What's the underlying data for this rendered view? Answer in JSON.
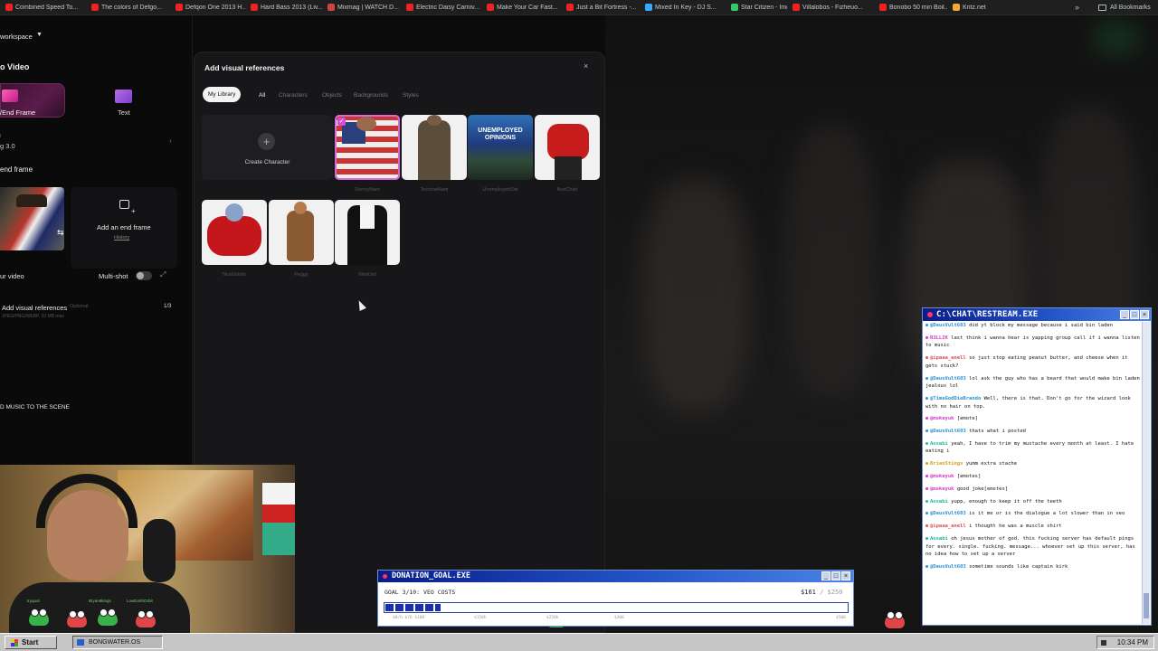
{
  "bookmarks": [
    {
      "label": "Combined Speed To...",
      "color": "#e22"
    },
    {
      "label": "The colors of Defgo...",
      "color": "#e22"
    },
    {
      "label": "Defqon One 2013 H...",
      "color": "#e22"
    },
    {
      "label": "Hard Bass 2013 (Liv...",
      "color": "#e22"
    },
    {
      "label": "Mixmag | WATCH D...",
      "color": "#c44"
    },
    {
      "label": "Electric Daisy Carniv...",
      "color": "#e22"
    },
    {
      "label": "Make Your Car Fast...",
      "color": "#e22"
    },
    {
      "label": "Just a Bit Fortress -...",
      "color": "#e22"
    },
    {
      "label": "Mixed In Key - DJ S...",
      "color": "#3af"
    },
    {
      "label": "Star Citizen - Imgur",
      "color": "#3c6"
    },
    {
      "label": "Villalobos - Fizheuo...",
      "color": "#e22"
    },
    {
      "label": "Bonobo 50 min Boil...",
      "color": "#e22"
    },
    {
      "label": "Kritz.net",
      "color": "#ea3"
    }
  ],
  "bookmarks_more": "»",
  "all_bookmarks": "All Bookmarks",
  "left_panel": {
    "workspace": "workspace",
    "section_title": "o Video",
    "mode_frame": "/End Frame",
    "mode_text": "Text",
    "model_small": "l",
    "model": "g 3.0",
    "model_chevron": "›",
    "end_frame_title": "end frame",
    "add_end_frame": "Add an end frame",
    "history": "History",
    "your_video": "ur video",
    "multishot": "Multi-shot",
    "expand": "⤢",
    "add_visual_refs": "Add visual references",
    "optional": "Optional",
    "refs_count": "1/3",
    "formats": "JPEG/PNG/WEBP, 10 MB max",
    "music": "D MUSIC TO THE SCENE"
  },
  "dialog": {
    "title": "Add visual references",
    "close": "×",
    "tab_library": "My Library",
    "categories": [
      "All",
      "Characters",
      "Objects",
      "Backgrounds",
      "Styles"
    ],
    "create_character": "Create Character",
    "create_plus": "+",
    "characters": [
      {
        "name": "DonnyNam",
        "selected": true
      },
      {
        "name": "TectoneNam",
        "selected": false
      },
      {
        "name": "UnemployedSet",
        "selected": false
      },
      {
        "name": "NuxChad",
        "selected": false
      },
      {
        "name": "NuxGoblin",
        "selected": false
      },
      {
        "name": "Peggy",
        "selected": false
      },
      {
        "name": "WestJet",
        "selected": false
      }
    ],
    "opinions_text": "UNEMPLOYED OPINIONS"
  },
  "chat": {
    "title": "C:\\CHAT\\RESTREAM.EXE",
    "messages": [
      {
        "user": "@DeusVult603",
        "color": "#2a8fd6",
        "text": "did yt block my message because i said bin laden"
      },
      {
        "user": "R3LLIK",
        "color": "#d637c9",
        "text": "last think i wanna hear is yapping group call if i wanna listen to music"
      },
      {
        "user": "@ipaaa_anell",
        "color": "#e05050",
        "text": "so just stop eating peanut butter, and cheese when it gets stuck?"
      },
      {
        "user": "@DeusVult603",
        "color": "#2a8fd6",
        "text": "lol ask the guy who has a beard that would make bin laden jealous lol"
      },
      {
        "user": "@TimeGodDieBrando",
        "color": "#2a8fd6",
        "text": "Well, there is that. Don't go for the wizard look with no hair on top."
      },
      {
        "user": "@mokeyuk",
        "color": "#d637c9",
        "text": "[emote]"
      },
      {
        "user": "@DeusVult603",
        "color": "#2a8fd6",
        "text": "thats what i posted"
      },
      {
        "user": "Aosabi",
        "color": "#1fb8a0",
        "text": "yeah, I have to trim my mustache every month at least. I hate eating i"
      },
      {
        "user": "BrianStings",
        "color": "#d8a020",
        "text": "yumm extra stache"
      },
      {
        "user": "@mokeyuk",
        "color": "#d637c9",
        "text": "[emotes]"
      },
      {
        "user": "@mokeyuk",
        "color": "#d637c9",
        "text": "good joke[emotes]"
      },
      {
        "user": "Aosabi",
        "color": "#1fb8a0",
        "text": "yupp, enough to keep it off the teeth"
      },
      {
        "user": "@DeusVult603",
        "color": "#2a8fd6",
        "text": "is it me or is the dialogue a lot slower than in veo"
      },
      {
        "user": "@ipaaa_anell",
        "color": "#e05050",
        "text": "i thought he was a muscle shirt"
      },
      {
        "user": "Aosabi",
        "color": "#1fb8a0",
        "text": "oh jesus mother of god. this fucking server has default pings for every. single. fucking. message... whoever set up this server, has no idea how to set up a server"
      },
      {
        "user": "@DeusVult603",
        "color": "#2a8fd6",
        "text": "sometime sounds like captain kirk"
      }
    ]
  },
  "donation": {
    "title": "DONATION_GOAL.EXE",
    "goal": "GOAL 3/10: VEO COSTS",
    "amount": "$161",
    "target": "/ $250",
    "progress": 0.12,
    "ticks": [
      "$0/h $76 $100",
      "$150h",
      "$250k",
      "$300",
      "$500"
    ]
  },
  "webcam": {
    "frogs": [
      "tryquot",
      "Bryan8kings",
      "LowEarthOrbit"
    ]
  },
  "taskbar": {
    "start": "Start",
    "task": "BONGWATER.OS",
    "clock": "10:34 PM"
  }
}
